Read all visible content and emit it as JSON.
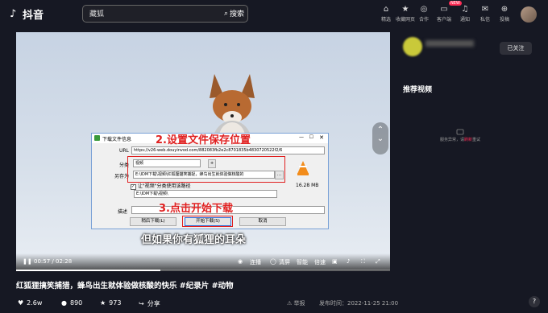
{
  "header": {
    "logo_text": "抖音",
    "search_value": "藏狐",
    "search_button": "搜索",
    "nav": [
      {
        "label": "精选",
        "icon": "home-icon"
      },
      {
        "label": "收藏网页",
        "icon": "bookmark-icon"
      },
      {
        "label": "合作",
        "icon": "handshake-icon"
      },
      {
        "label": "客户端",
        "icon": "monitor-icon"
      },
      {
        "label": "通知",
        "icon": "bell-icon"
      },
      {
        "label": "私信",
        "icon": "message-icon"
      },
      {
        "label": "投稿",
        "icon": "upload-icon"
      }
    ],
    "new_badge": "NEW"
  },
  "video": {
    "subtitle": "但如果你有狐狸的耳朵",
    "time_current": "00:57",
    "time_total": "02:28",
    "controls": [
      "连播",
      "清屏",
      "智能",
      "倍速"
    ],
    "progress": 0.385
  },
  "dialog": {
    "title": "下载文件信息",
    "url_label": "URL",
    "url_value": "https://v26-web.douyinvod.com/882083fb2e2c8701835b4830720522f2/6",
    "category_label": "分类",
    "category_value": "视频",
    "save_label": "另存为",
    "save_value": "E:\\IDM下载\\视频\\红狐狸猫笑捕捉，蜂鸟出生就体验做核酸的",
    "remember_checkbox": "让\"视频\"分类使用该路径",
    "path_value": "E:\\IDM下载\\视频\\",
    "desc_label": "描述",
    "size": "16.28 MB",
    "btn_later": "稍后下载(L)",
    "btn_start": "开始下载(S)",
    "btn_cancel": "取消",
    "annotation_top": "2.设置文件保存位置",
    "annotation_bottom": "3.点击开始下载"
  },
  "right_panel": {
    "follow_button": "已关注",
    "heading": "推荐视频",
    "error_text": "服务异常，请",
    "error_link": "刷新",
    "error_suffix": "重试"
  },
  "bottom": {
    "title": "红狐狸搞笑捕猎，蜂鸟出生就体验做核酸的快乐 #纪录片 #动物",
    "likes": "2.6w",
    "comments": "890",
    "favorites": "973",
    "share": "分享",
    "report": "举报",
    "publish_time": "发布时间：2022-11-25 21:00"
  },
  "colors": {
    "accent": "#fe2c55",
    "annotation": "#e02020",
    "background": "#161823"
  }
}
